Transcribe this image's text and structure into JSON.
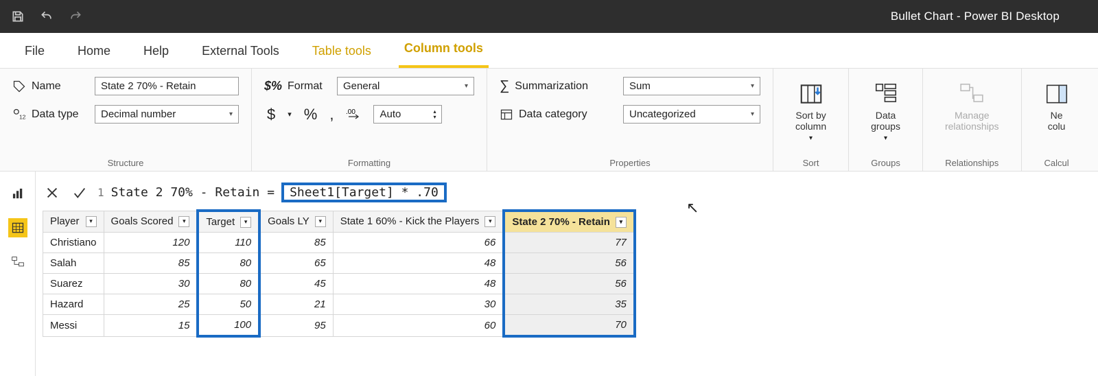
{
  "titlebar": {
    "title": "Bullet Chart - Power BI Desktop"
  },
  "menu": {
    "file": "File",
    "home": "Home",
    "help": "Help",
    "external": "External Tools",
    "tabletools": "Table tools",
    "coltools": "Column tools"
  },
  "ribbon": {
    "name_label": "Name",
    "name_value": "State 2 70% - Retain",
    "datatype_label": "Data type",
    "datatype_value": "Decimal number",
    "format_label": "Format",
    "format_value": "General",
    "auto_value": "Auto",
    "sum_label": "Summarization",
    "sum_value": "Sum",
    "cat_label": "Data category",
    "cat_value": "Uncategorized",
    "sort_label": "Sort by\ncolumn",
    "groups_label": "Data\ngroups",
    "rel_label": "Manage\nrelationships",
    "newcol_label": "Ne\ncolu",
    "grp_structure": "Structure",
    "grp_formatting": "Formatting",
    "grp_properties": "Properties",
    "grp_sort": "Sort",
    "grp_groups": "Groups",
    "grp_rel": "Relationships",
    "grp_calc": "Calcul"
  },
  "formula": {
    "line": "1",
    "lead": "State 2 70% - Retain =",
    "expr": "Sheet1[Target] * .70"
  },
  "table": {
    "columns": [
      "Player",
      "Goals Scored",
      "Target",
      "Goals LY",
      "State 1 60% - Kick the Players",
      "State 2 70% - Retain"
    ],
    "rows": [
      {
        "player": "Christiano",
        "goals": "120",
        "target": "110",
        "ly": "85",
        "s1": "66",
        "s2": "77"
      },
      {
        "player": "Salah",
        "goals": "85",
        "target": "80",
        "ly": "65",
        "s1": "48",
        "s2": "56"
      },
      {
        "player": "Suarez",
        "goals": "30",
        "target": "80",
        "ly": "45",
        "s1": "48",
        "s2": "56"
      },
      {
        "player": "Hazard",
        "goals": "25",
        "target": "50",
        "ly": "21",
        "s1": "30",
        "s2": "35"
      },
      {
        "player": "Messi",
        "goals": "15",
        "target": "100",
        "ly": "95",
        "s1": "60",
        "s2": "70"
      }
    ]
  },
  "chart_data": {
    "type": "table",
    "title": "Bullet Chart data",
    "columns": [
      "Player",
      "Goals Scored",
      "Target",
      "Goals LY",
      "State 1 60% - Kick the Players",
      "State 2 70% - Retain"
    ],
    "data": [
      [
        "Christiano",
        120,
        110,
        85,
        66,
        77
      ],
      [
        "Salah",
        85,
        80,
        65,
        48,
        56
      ],
      [
        "Suarez",
        30,
        80,
        45,
        48,
        56
      ],
      [
        "Hazard",
        25,
        50,
        21,
        30,
        35
      ],
      [
        "Messi",
        15,
        100,
        95,
        60,
        70
      ]
    ]
  }
}
